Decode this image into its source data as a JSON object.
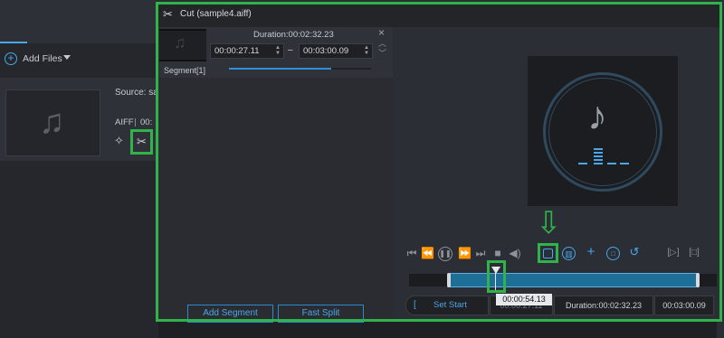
{
  "toolbar": {
    "add_files_label": "Add Files"
  },
  "file": {
    "source_label": "Source: sar",
    "format_label": "AIFF",
    "time_fragment": "00:"
  },
  "dialog": {
    "title": "Cut (sample4.aiff)",
    "segment": {
      "name": "Segment[1]",
      "duration": "Duration:00:02:32.23",
      "start": "00:00:27.11",
      "end": "00:03:00.09",
      "dash": "–"
    },
    "buttons": {
      "add_segment": "Add Segment",
      "fast_split": "Fast Split"
    },
    "bottom": {
      "bracket": "[",
      "set_start": "Set Start",
      "start_value": "00:00:27.11",
      "duration": "Duration:00:02:32.23",
      "end_value": "00:03:00.09"
    },
    "playhead_time": "00:00:54.13"
  },
  "colors": {
    "accent": "#4aa7e8",
    "highlight": "#2fb34a",
    "timeline": "#1d6f98"
  },
  "icons": {
    "close": "×",
    "up": "︿",
    "down": "﹀",
    "scissors": "✂",
    "music": "♪",
    "prev": "|◁",
    "rewind": "◁◁",
    "pause": "⏸",
    "forward": "▷▷",
    "next": "▷|",
    "stop": "☐",
    "volume": "🔈",
    "split": "⫽",
    "delete": "🗑",
    "add": "+",
    "copy": "⧉",
    "undo": "↺",
    "bracket_in": "[▷]",
    "bracket_out": "[□]",
    "arrow_down": "⇩"
  }
}
